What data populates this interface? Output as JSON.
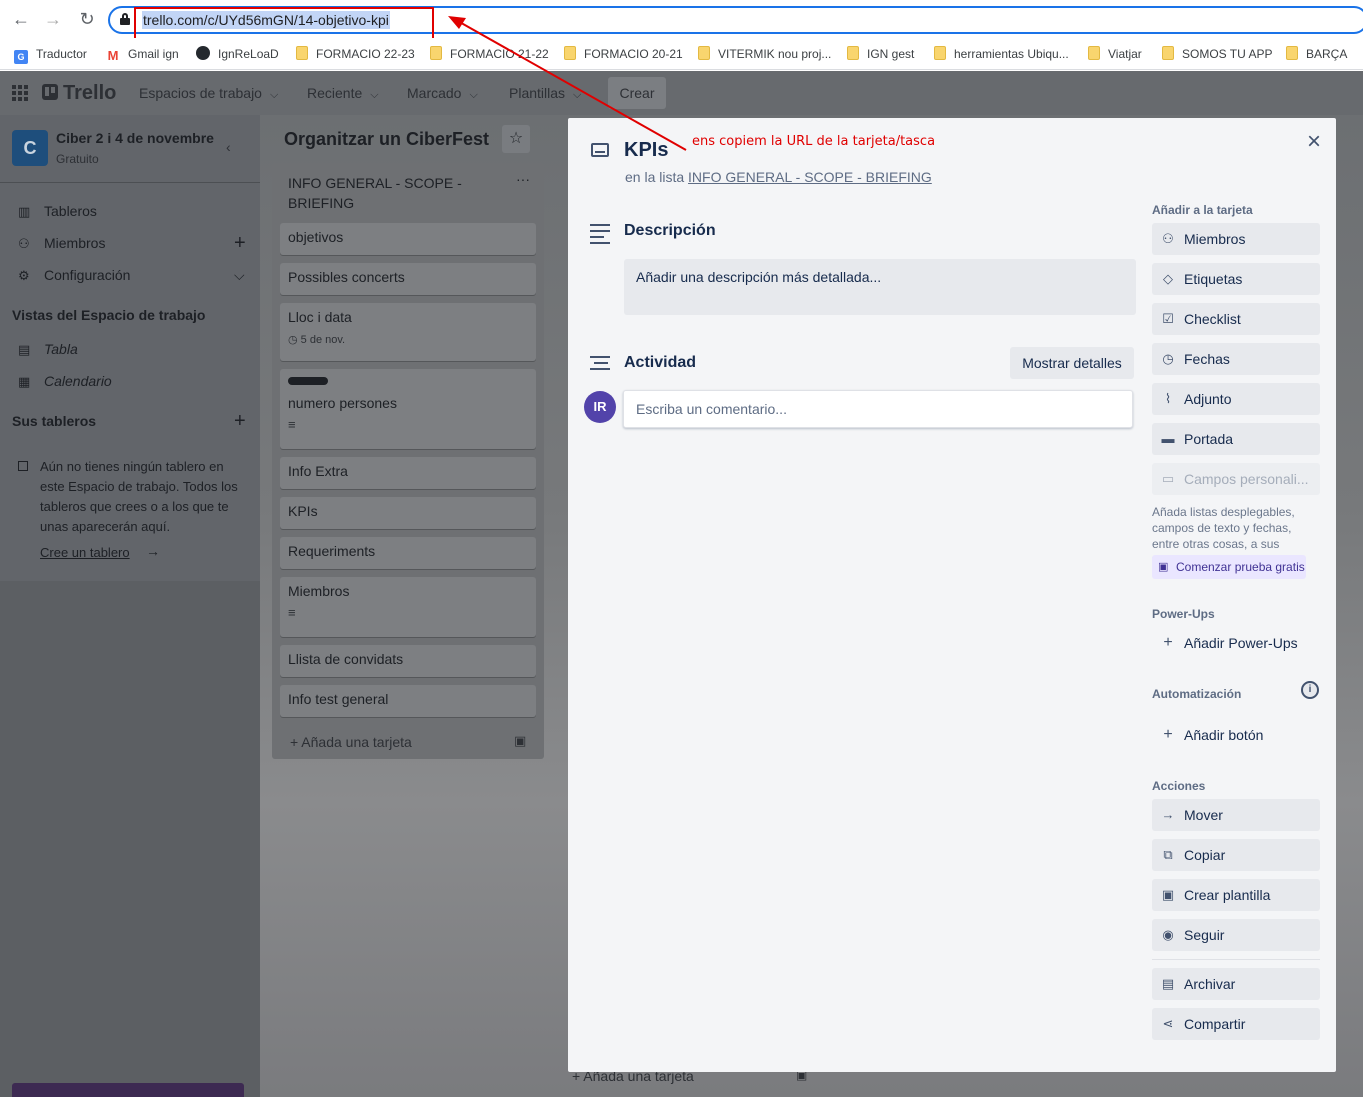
{
  "browser": {
    "url": "trello.com/c/UYd56mGN/14-objetivo-kpi",
    "bookmarks": [
      {
        "label": "Traductor",
        "icon": "google-translate-icon"
      },
      {
        "label": "Gmail ign",
        "icon": "gmail-icon"
      },
      {
        "label": "IgnReLoaD",
        "icon": "github-icon"
      },
      {
        "label": "FORMACIO 22-23",
        "icon": "folder-icon"
      },
      {
        "label": "FORMACIO 21-22",
        "icon": "folder-icon"
      },
      {
        "label": "FORMACIO 20-21",
        "icon": "folder-icon"
      },
      {
        "label": "VITERMIK nou proj...",
        "icon": "folder-icon"
      },
      {
        "label": "IGN gest",
        "icon": "folder-icon"
      },
      {
        "label": "herramientas Ubiqu...",
        "icon": "folder-icon"
      },
      {
        "label": "Viatjar",
        "icon": "folder-icon"
      },
      {
        "label": "SOMOS TU APP",
        "icon": "folder-icon"
      },
      {
        "label": "BARÇA",
        "icon": "folder-icon"
      }
    ]
  },
  "header": {
    "logo": "Trello",
    "nav": [
      "Espacios de trabajo",
      "Reciente",
      "Marcado",
      "Plantillas"
    ],
    "create": "Crear"
  },
  "sidebar": {
    "workspace_initial": "C",
    "workspace_name": "Ciber 2 i 4 de novembre",
    "workspace_plan": "Gratuito",
    "items": [
      "Tableros",
      "Miembros",
      "Configuración"
    ],
    "views_heading": "Vistas del Espacio de trabajo",
    "views": [
      "Tabla",
      "Calendario"
    ],
    "boards_heading": "Sus tableros",
    "empty_note": "Aún no tienes ningún tablero en este Espacio de trabajo. Todos los tableros que crees o a los que te unas aparecerán aquí.",
    "create_link": "Cree un tablero"
  },
  "board": {
    "title": "Organitzar un CiberFest",
    "list": {
      "title": "INFO GENERAL - SCOPE - BRIEFING",
      "cards": [
        "objetivos",
        "Possibles concerts",
        "Lloc i data",
        "numero persones",
        "Info Extra",
        "KPIs",
        "Requeriments",
        "Miembros",
        "Llista de convidats",
        "Info test general"
      ],
      "date_badge": "5 de nov.",
      "add_card": "Añada una tarjeta"
    },
    "list2_add_card": "Añada una tarjeta"
  },
  "modal": {
    "title": "KPIs",
    "in_list_prefix": "en la lista",
    "in_list_name": "INFO GENERAL - SCOPE - BRIEFING",
    "description_title": "Descripción",
    "description_placeholder": "Añadir una descripción más detallada...",
    "activity_title": "Actividad",
    "show_details": "Mostrar detalles",
    "avatar_initials": "IR",
    "comment_placeholder": "Escriba un comentario...",
    "add_to_card_label": "Añadir a la tarjeta",
    "add_to_card": [
      "Miembros",
      "Etiquetas",
      "Checklist",
      "Fechas",
      "Adjunto",
      "Portada",
      "Campos personali..."
    ],
    "custom_fields_note": "Añada listas desplegables, campos de texto y fechas, entre otras cosas, a sus tarjetas.",
    "trial_button": "Comenzar prueba gratis",
    "powerups_label": "Power-Ups",
    "add_powerups": "Añadir Power-Ups",
    "automation_label": "Automatización",
    "add_button": "Añadir botón",
    "actions_label": "Acciones",
    "actions": [
      "Mover",
      "Copiar",
      "Crear plantilla",
      "Seguir",
      "Archivar",
      "Compartir"
    ]
  },
  "annotation": {
    "text": "ens copiem la URL de la tarjeta/tasca",
    "color": "#e00000"
  }
}
